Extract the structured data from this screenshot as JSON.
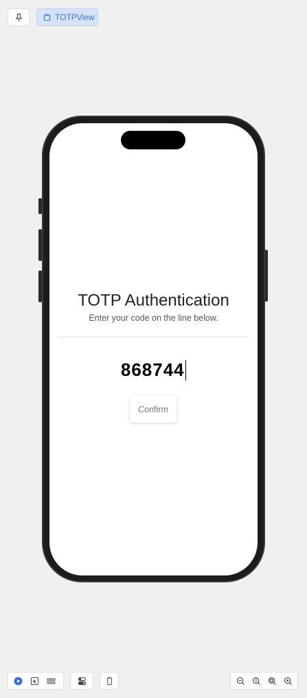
{
  "toolbar_top": {
    "pin_icon": "pin-icon",
    "view_chip": {
      "icon": "cube-icon",
      "label": "TOTPView"
    }
  },
  "screen": {
    "title": "TOTP Authentication",
    "subtitle": "Enter your code on the line below.",
    "code_value": "868744",
    "confirm_label": "Confirm"
  },
  "toolbar_bottom": {
    "icons": [
      "play-icon",
      "select-icon",
      "grid-icon",
      "variants-icon",
      "device-icon",
      "zoom-out-icon",
      "zoom-actual-icon",
      "zoom-fit-icon",
      "zoom-in-icon"
    ]
  },
  "colors": {
    "accent": "#3b6fd6",
    "chip_bg": "#d6e2f7",
    "background": "#f0f0f0"
  }
}
